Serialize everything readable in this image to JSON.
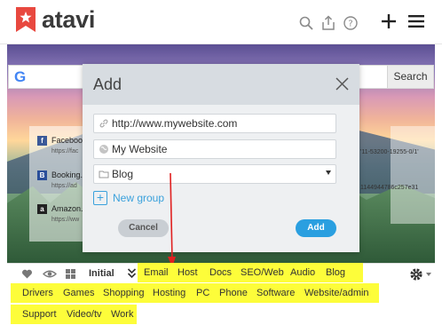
{
  "app": {
    "name": "atavi"
  },
  "search": {
    "engine_label": "G",
    "button_label": "Search"
  },
  "bookmarks": [
    {
      "icon_letter": "f",
      "icon_color": "#3b5998",
      "title": "Facebook",
      "url": "https://fac"
    },
    {
      "icon_letter": "B",
      "icon_color": "#2a4e9a",
      "title": "Booking.c",
      "url": "https://ad"
    },
    {
      "icon_letter": "a",
      "icon_color": "#222222",
      "title": "Amazon.c",
      "url": "https://ww"
    }
  ],
  "background_text": [
    "'11-53200-19255-0/1'",
    "1144944786c257e31"
  ],
  "modal": {
    "title": "Add",
    "url_value": "http://www.mywebsite.com",
    "name_value": "My Website",
    "group_value": "Blog",
    "new_group_label": "New group",
    "cancel_label": "Cancel",
    "add_label": "Add"
  },
  "bottom_bar": {
    "initial_label": "Initial",
    "groups_row1": [
      "Email",
      "Host",
      "Docs",
      "SEO/Web",
      "Audio",
      "Blog"
    ],
    "groups_row2": [
      "Drivers",
      "Games",
      "Shopping",
      "Hosting",
      "PC",
      "Phone",
      "Software",
      "Website/admin"
    ],
    "groups_row3": [
      "Support",
      "Video/tv",
      "Work"
    ]
  },
  "colors": {
    "logo_red": "#e8483f",
    "accent_blue": "#2a9fe0",
    "highlight_yellow": "#fdfd3a",
    "annotation_red": "#e02020"
  }
}
